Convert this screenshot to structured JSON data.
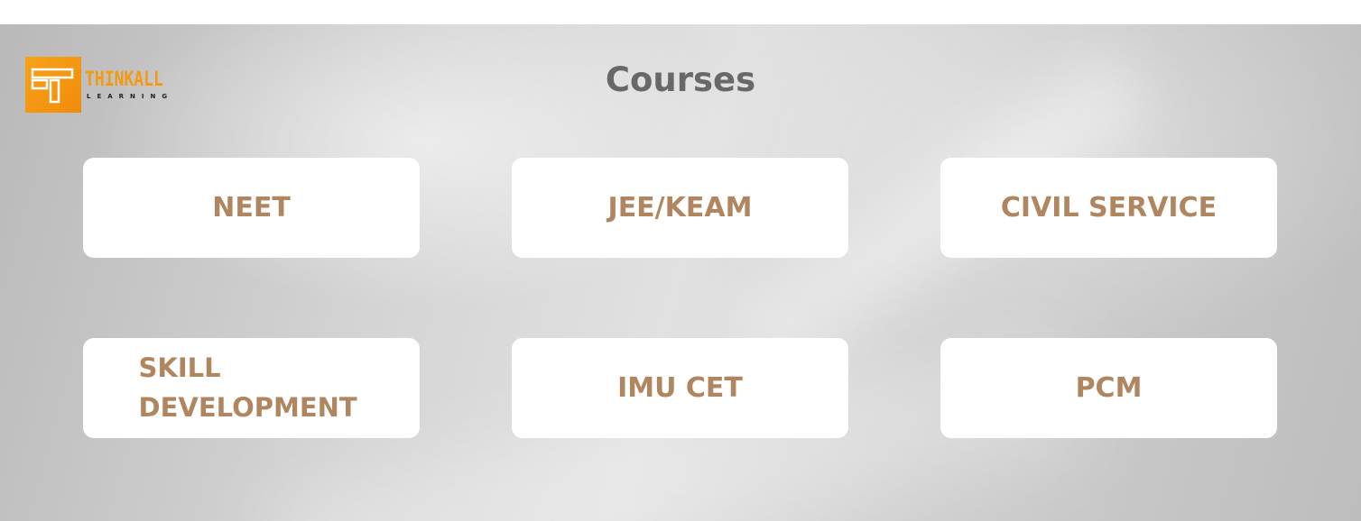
{
  "logo": {
    "brand": "THINKALL",
    "sub": "LEARNING"
  },
  "heading": "Courses",
  "courses": [
    {
      "label": "NEET"
    },
    {
      "label": "JEE/KEAM"
    },
    {
      "label": "CIVIL SERVICE"
    },
    {
      "label": "SKILL DEVELOPMENT"
    },
    {
      "label": "IMU CET"
    },
    {
      "label": "PCM"
    }
  ],
  "colors": {
    "accent": "#b08660",
    "heading": "#686868",
    "logo_orange": "#f39a12"
  }
}
